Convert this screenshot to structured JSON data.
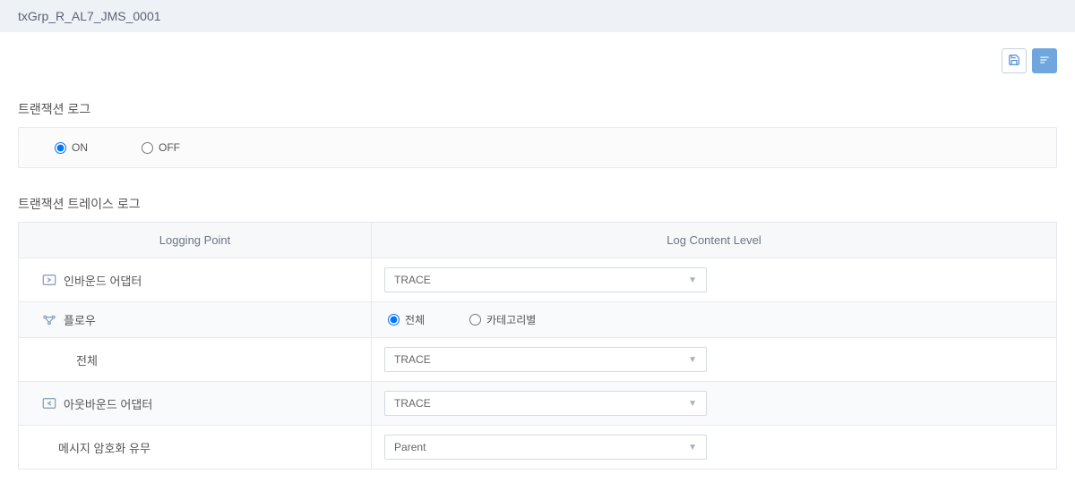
{
  "header": {
    "title": "txGrp_R_AL7_JMS_0001"
  },
  "sections": {
    "txlog_title": "트랜잭션 로그",
    "trace_title": "트랜잭션 트레이스 로그"
  },
  "txlog": {
    "on_label": "ON",
    "off_label": "OFF"
  },
  "trace": {
    "col_logging_point": "Logging Point",
    "col_log_level": "Log Content Level",
    "rows": {
      "inbound_label": "인바운드 어댑터",
      "inbound_value": "TRACE",
      "flow_label": "플로우",
      "flow_radio_all": "전체",
      "flow_radio_cat": "카테고리별",
      "flow_all_label": "전체",
      "flow_all_value": "TRACE",
      "outbound_label": "아웃바운드 어댑터",
      "outbound_value": "TRACE",
      "encrypt_label": "메시지 암호화 유무",
      "encrypt_value": "Parent"
    }
  }
}
